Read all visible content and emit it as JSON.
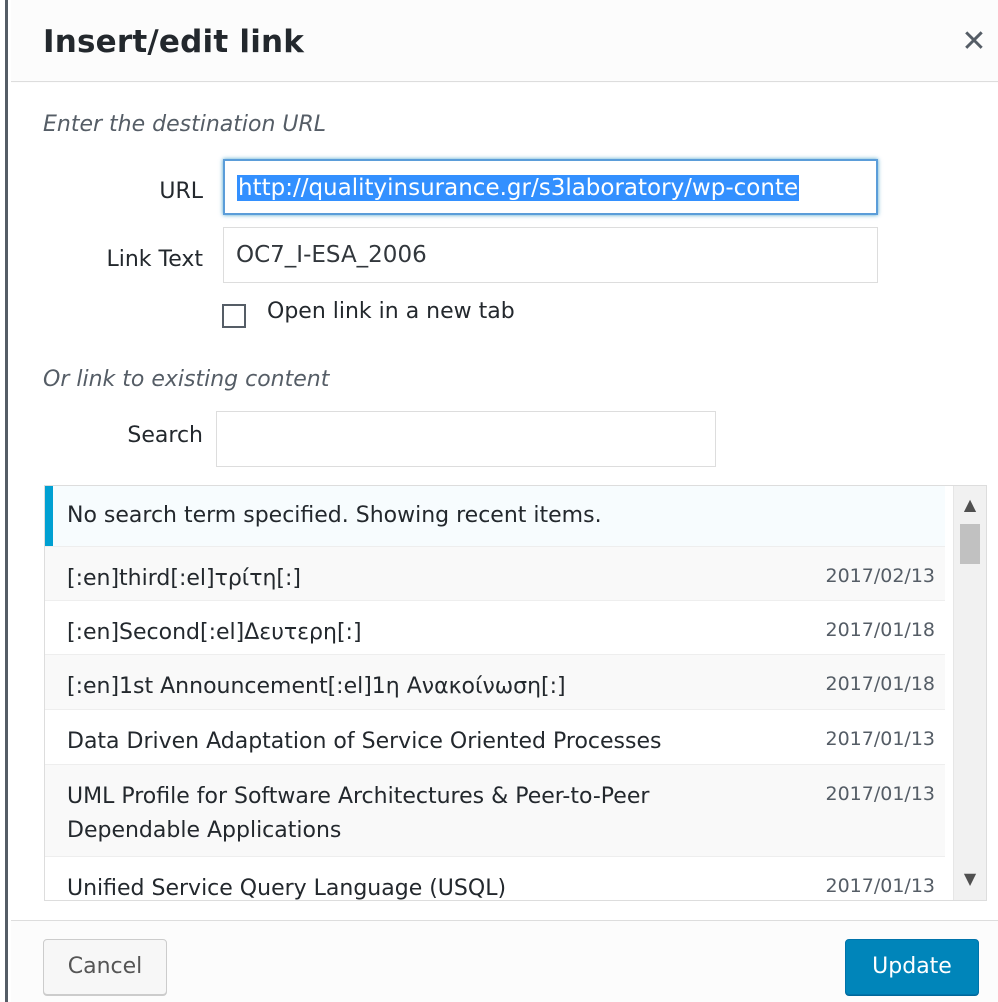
{
  "dialog": {
    "title": "Insert/edit link",
    "close_icon": "close-icon"
  },
  "url_section": {
    "heading": "Enter the destination URL",
    "url_label": "URL",
    "url_value": "http://qualityinsurance.gr/s3laboratory/wp-conte",
    "link_text_label": "Link Text",
    "link_text_value": "OC7_I-ESA_2006",
    "new_tab_label": "Open link in a new tab",
    "new_tab_checked": false
  },
  "search_section": {
    "heading": "Or link to existing content",
    "search_label": "Search",
    "search_value": "",
    "notice": "No search term specified. Showing recent items.",
    "results": [
      {
        "title": "[:en]third[:el]τρίτη[:]",
        "date": "2017/02/13"
      },
      {
        "title": "[:en]Second[:el]Δευτερη[:]",
        "date": "2017/01/18"
      },
      {
        "title": "[:en]1st Announcement[:el]1η Ανακοίνωση[:]",
        "date": "2017/01/18"
      },
      {
        "title": "Data Driven Adaptation of Service Oriented Processes",
        "date": "2017/01/13"
      },
      {
        "title": "UML Profile for Software Architectures & Peer-to-Peer Dependable Applications",
        "date": "2017/01/13"
      },
      {
        "title": "Unified Service Query Language (USQL)",
        "date": "2017/01/13"
      }
    ]
  },
  "footer": {
    "cancel_label": "Cancel",
    "update_label": "Update"
  },
  "colors": {
    "accent": "#0085ba",
    "notice_border": "#00a0d2",
    "focus": "#5b9dd9"
  }
}
